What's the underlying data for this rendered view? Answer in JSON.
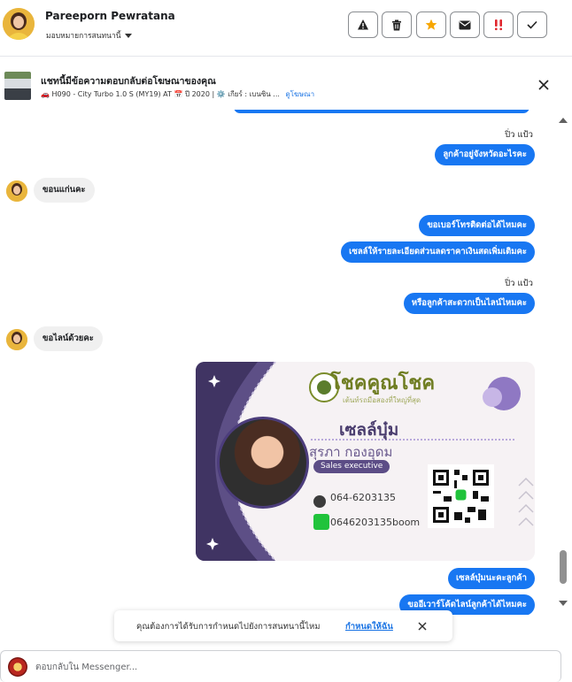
{
  "header": {
    "contact_name": "Pareeporn Pewratana",
    "assign_label": "มอบหมายการสนทนานี้",
    "actions": [
      {
        "name": "spam-warning",
        "icon": "warning-triangle-icon"
      },
      {
        "name": "delete",
        "icon": "trash-icon"
      },
      {
        "name": "star",
        "icon": "star-icon",
        "color": "#f7a600"
      },
      {
        "name": "mark-unread",
        "icon": "envelope-icon"
      },
      {
        "name": "follow-up",
        "icon": "double-exclamation-icon",
        "color": "#e0262d"
      },
      {
        "name": "mark-done",
        "icon": "checkmark-icon"
      }
    ]
  },
  "ad": {
    "title": "แชทนี้มีข้อความตอบกลับต่อโฆษณาของคุณ",
    "subtitle": "🚗 H090 - City Turbo 1.0 S (MY19) AT 📅 ปี 2020 | ⚙️ เกียร์ : เบนซิน ...",
    "link_label": "ดูโฆษณา"
  },
  "messages": [
    {
      "side": "out",
      "sender": "ปิ่ว แป้ว",
      "text": "ลูกค้าอยู่จังหวัดอะไรคะ"
    },
    {
      "side": "in",
      "text": "ขอนแก่นคะ"
    },
    {
      "side": "out",
      "text": "ขอเบอร์โทรติดต่อได้ไหมคะ"
    },
    {
      "side": "out",
      "text": "เซลล์ให้รายละเอียดส่วนลดราคาเงินสดเพิ่มเติมคะ"
    },
    {
      "side": "out",
      "sender": "ปิ่ว แป้ว",
      "text": "หรือลูกค้าสะดวกเป็นไลน์ไหมคะ"
    },
    {
      "side": "in",
      "text": "ขอไลน์ด้วยคะ"
    },
    {
      "side": "out",
      "text": "เซลล์บุ๋มนะคะลูกค้า"
    },
    {
      "side": "out",
      "text": "ขออีเวาร์โค้ดไลน์ลูกค้าได้ไหมคะ"
    }
  ],
  "card": {
    "brand": "โชคคูณโชค",
    "tagline": "เต้นท์รถมือสองที่ใหญ่ที่สุด",
    "nickname": "เซลล์บุ๋ม",
    "full_name": "สุรภา    กองอุดม",
    "role": "Sales executive",
    "phone": "064-6203135",
    "line_id": "0646203135boom"
  },
  "toast": {
    "text": "คุณต้องการได้รับการกำหนดไปยังการสนทนานี้ไหม",
    "link_label": "กำหนดให้ฉัน"
  },
  "composer": {
    "placeholder": "ตอบกลับใน Messenger..."
  }
}
